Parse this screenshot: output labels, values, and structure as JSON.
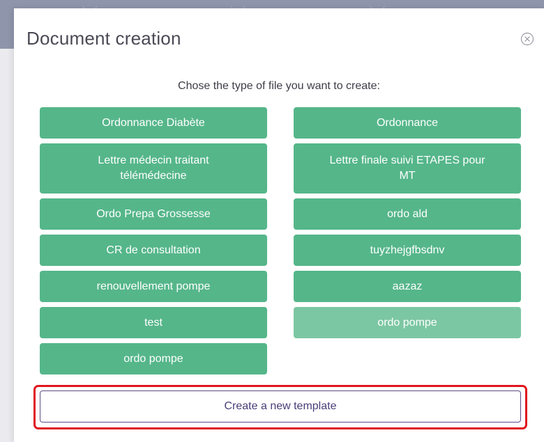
{
  "modal": {
    "title": "Document creation",
    "subtitle": "Chose the type of file you want to create:",
    "close_icon": "close-circle-icon"
  },
  "templates": [
    {
      "label": "Ordonnance Diabète",
      "faded": false
    },
    {
      "label": "Ordonnance",
      "faded": false
    },
    {
      "label": "Lettre médecin traitant télémédecine",
      "faded": false
    },
    {
      "label": "Lettre finale suivi ETAPES pour MT",
      "faded": false
    },
    {
      "label": "Ordo Prepa Grossesse",
      "faded": false
    },
    {
      "label": "ordo ald",
      "faded": false
    },
    {
      "label": "CR de consultation",
      "faded": false
    },
    {
      "label": "tuyzhejgfbsdnv",
      "faded": false
    },
    {
      "label": "renouvellement pompe",
      "faded": false
    },
    {
      "label": "aazaz",
      "faded": false
    },
    {
      "label": "test",
      "faded": false
    },
    {
      "label": "ordo pompe",
      "faded": true
    },
    {
      "label": "ordo pompe",
      "faded": false
    }
  ],
  "create_button": {
    "label": "Create a new template"
  },
  "colors": {
    "template_button": "#55b68a",
    "template_button_hover": "#7cc7a3",
    "create_border": "#5d4b86",
    "highlight": "#e0151f"
  }
}
